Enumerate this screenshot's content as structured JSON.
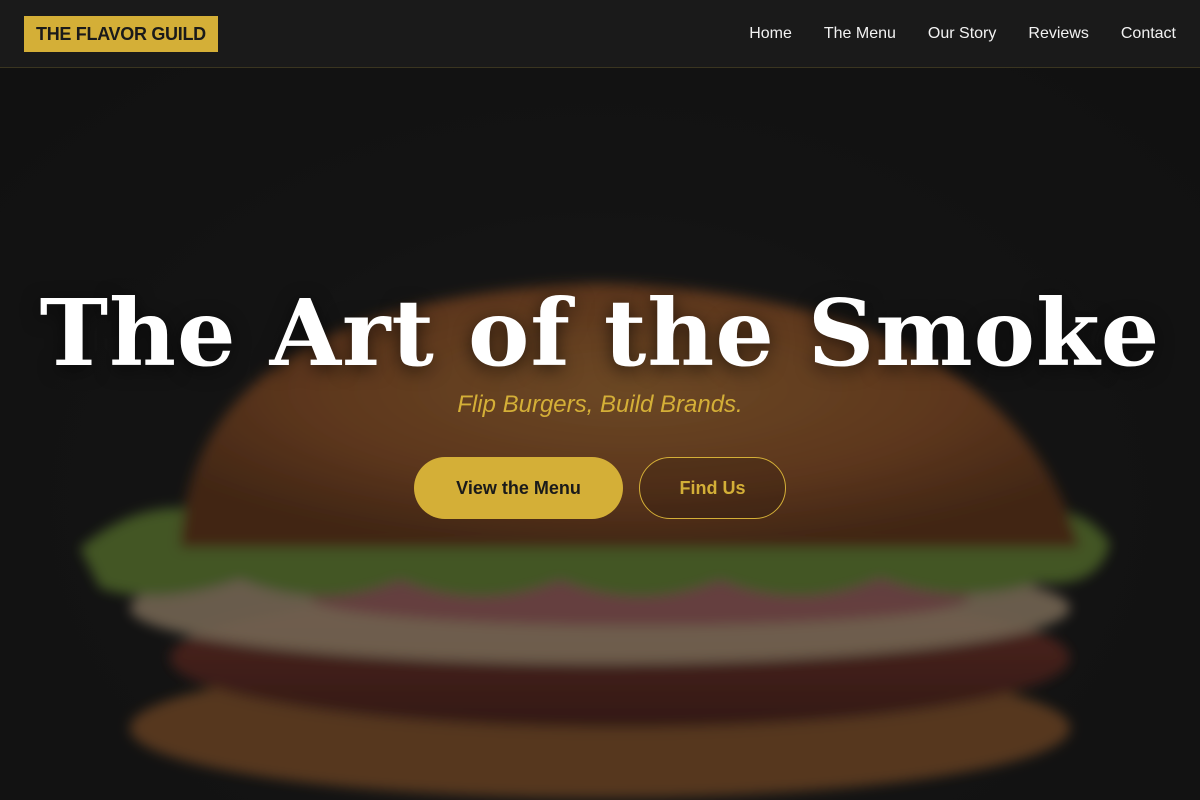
{
  "brand": {
    "name": "THE FLAVOR GUILD",
    "accent_color": "#d4af37"
  },
  "nav": {
    "items": [
      {
        "label": "Home"
      },
      {
        "label": "The Menu"
      },
      {
        "label": "Our Story"
      },
      {
        "label": "Reviews"
      },
      {
        "label": "Contact"
      }
    ]
  },
  "hero": {
    "title": "The Art of the Smoke",
    "tagline": "Flip Burgers, Build Brands.",
    "background_image": "burger-photo",
    "primary_button": "View the Menu",
    "secondary_button": "Find Us"
  },
  "colors": {
    "background": "#121212",
    "header": "#1a1a1a",
    "accent": "#d4af37",
    "text": "#ffffff"
  }
}
